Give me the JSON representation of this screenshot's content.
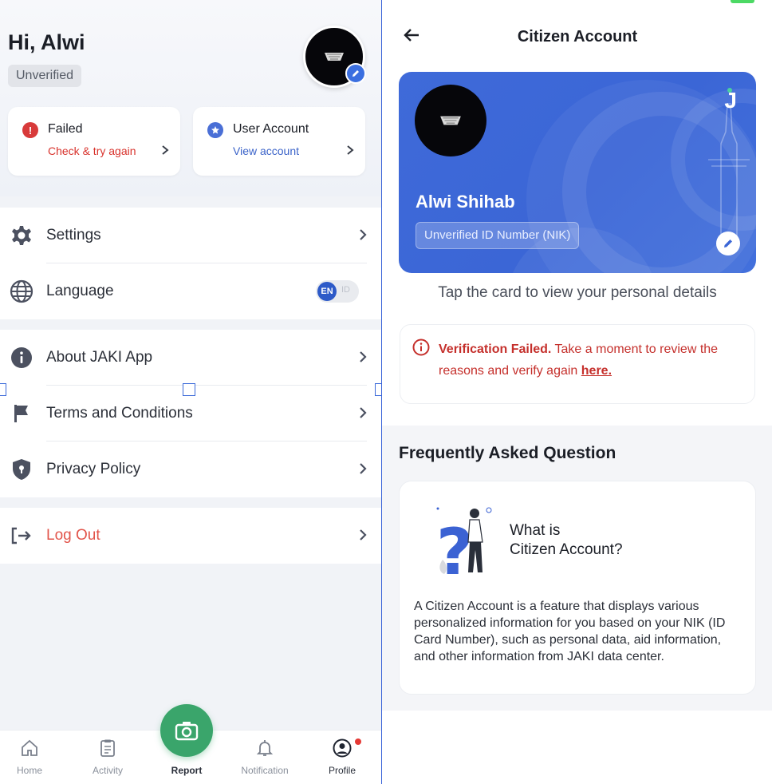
{
  "profile": {
    "greeting": "Hi, Alwi",
    "status": "Unverified",
    "failed_card": {
      "title": "Failed",
      "subtitle": "Check & try again"
    },
    "account_card": {
      "title": "User Account",
      "subtitle": "View account"
    },
    "menu_general": [
      {
        "label": "Settings",
        "icon": "gear-icon"
      },
      {
        "label": "Language",
        "icon": "globe-icon"
      }
    ],
    "language": {
      "selected": "EN",
      "other": "ID"
    },
    "menu_info": [
      {
        "label": "About JAKI App",
        "icon": "info-icon"
      },
      {
        "label": "Terms and Conditions",
        "icon": "flag-icon"
      },
      {
        "label": "Privacy Policy",
        "icon": "shield-icon"
      }
    ],
    "logout": {
      "label": "Log Out",
      "color": "#e2554b"
    },
    "nav": [
      {
        "label": "Home",
        "icon": "home-icon"
      },
      {
        "label": "Activity",
        "icon": "clipboard-icon"
      },
      {
        "label": "Report",
        "icon": "camera-icon",
        "active": true
      },
      {
        "label": "Notification",
        "icon": "bell-icon"
      },
      {
        "label": "Profile",
        "icon": "user-icon"
      }
    ]
  },
  "citizen": {
    "title": "Citizen Account",
    "card": {
      "name": "Alwi Shihab",
      "id_status": "Unverified ID Number (NIK)",
      "brand": "J"
    },
    "tap_hint": "Tap the card to view your personal details",
    "alert": {
      "strong": "Verification Failed.",
      "text": " Take a moment to review the reasons and verify again ",
      "link": "here."
    },
    "faq": {
      "heading": "Frequently Asked Question",
      "question_line1": "What is",
      "question_line2": "Citizen Account?",
      "answer": "A Citizen Account is a feature that displays various personalized information for you based on your NIK (ID Card Number), such as personal data, aid information, and other information from JAKI data center."
    }
  },
  "colors": {
    "accent": "#3b6fe0",
    "card_blue": "#3f6ad9",
    "danger": "#c5302c",
    "report_green": "#3aa56b"
  }
}
